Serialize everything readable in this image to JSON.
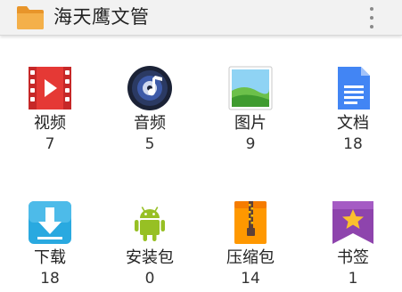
{
  "app": {
    "title": "海天鹰文管",
    "app_icon": "folder-icon",
    "overflow_icon": "more-vert-icon"
  },
  "categories": [
    {
      "label": "视频",
      "count": "7",
      "icon": "video-icon",
      "color": "#e53935"
    },
    {
      "label": "音频",
      "count": "5",
      "icon": "audio-disc-icon",
      "color": "#1e2a44"
    },
    {
      "label": "图片",
      "count": "9",
      "icon": "picture-icon",
      "color": "#4caf50"
    },
    {
      "label": "文档",
      "count": "18",
      "icon": "document-icon",
      "color": "#4285f4"
    },
    {
      "label": "下载",
      "count": "18",
      "icon": "download-icon",
      "color": "#29a9e0"
    },
    {
      "label": "安装包",
      "count": "0",
      "icon": "android-icon",
      "color": "#97c024"
    },
    {
      "label": "压缩包",
      "count": "14",
      "icon": "archive-icon",
      "color": "#ff9800"
    },
    {
      "label": "书签",
      "count": "1",
      "icon": "bookmark-icon",
      "color": "#8e44ad"
    }
  ]
}
